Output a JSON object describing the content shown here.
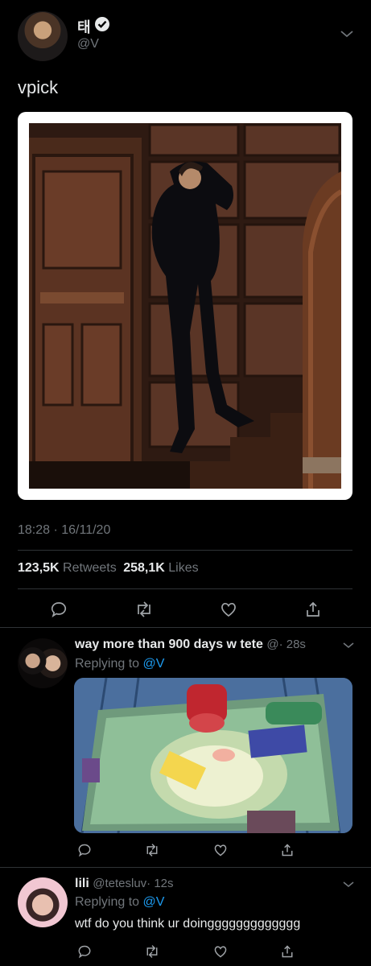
{
  "main_tweet": {
    "author_name": "태",
    "handle": "@V",
    "text": "vpick",
    "timestamp": "18:28 · 16/11/20",
    "retweets_count": "123,5K",
    "retweets_label": "Retweets",
    "likes_count": "258,1K",
    "likes_label": "Likes"
  },
  "replies": [
    {
      "author_name": "way more than 900 days w tete",
      "handle": "@",
      "time": "· 28s",
      "replying_to_label": "Replying to",
      "replying_to_handle": "@V"
    },
    {
      "author_name": "lili",
      "handle": "@tetesluv",
      "time": "· 12s",
      "replying_to_label": "Replying to",
      "replying_to_handle": "@V",
      "text": "wtf do you think ur doinggggggggggggg"
    }
  ],
  "colors": {
    "background": "#000000",
    "accent": "#1d9bf0",
    "muted": "#71767b",
    "divider": "#2f3336"
  }
}
